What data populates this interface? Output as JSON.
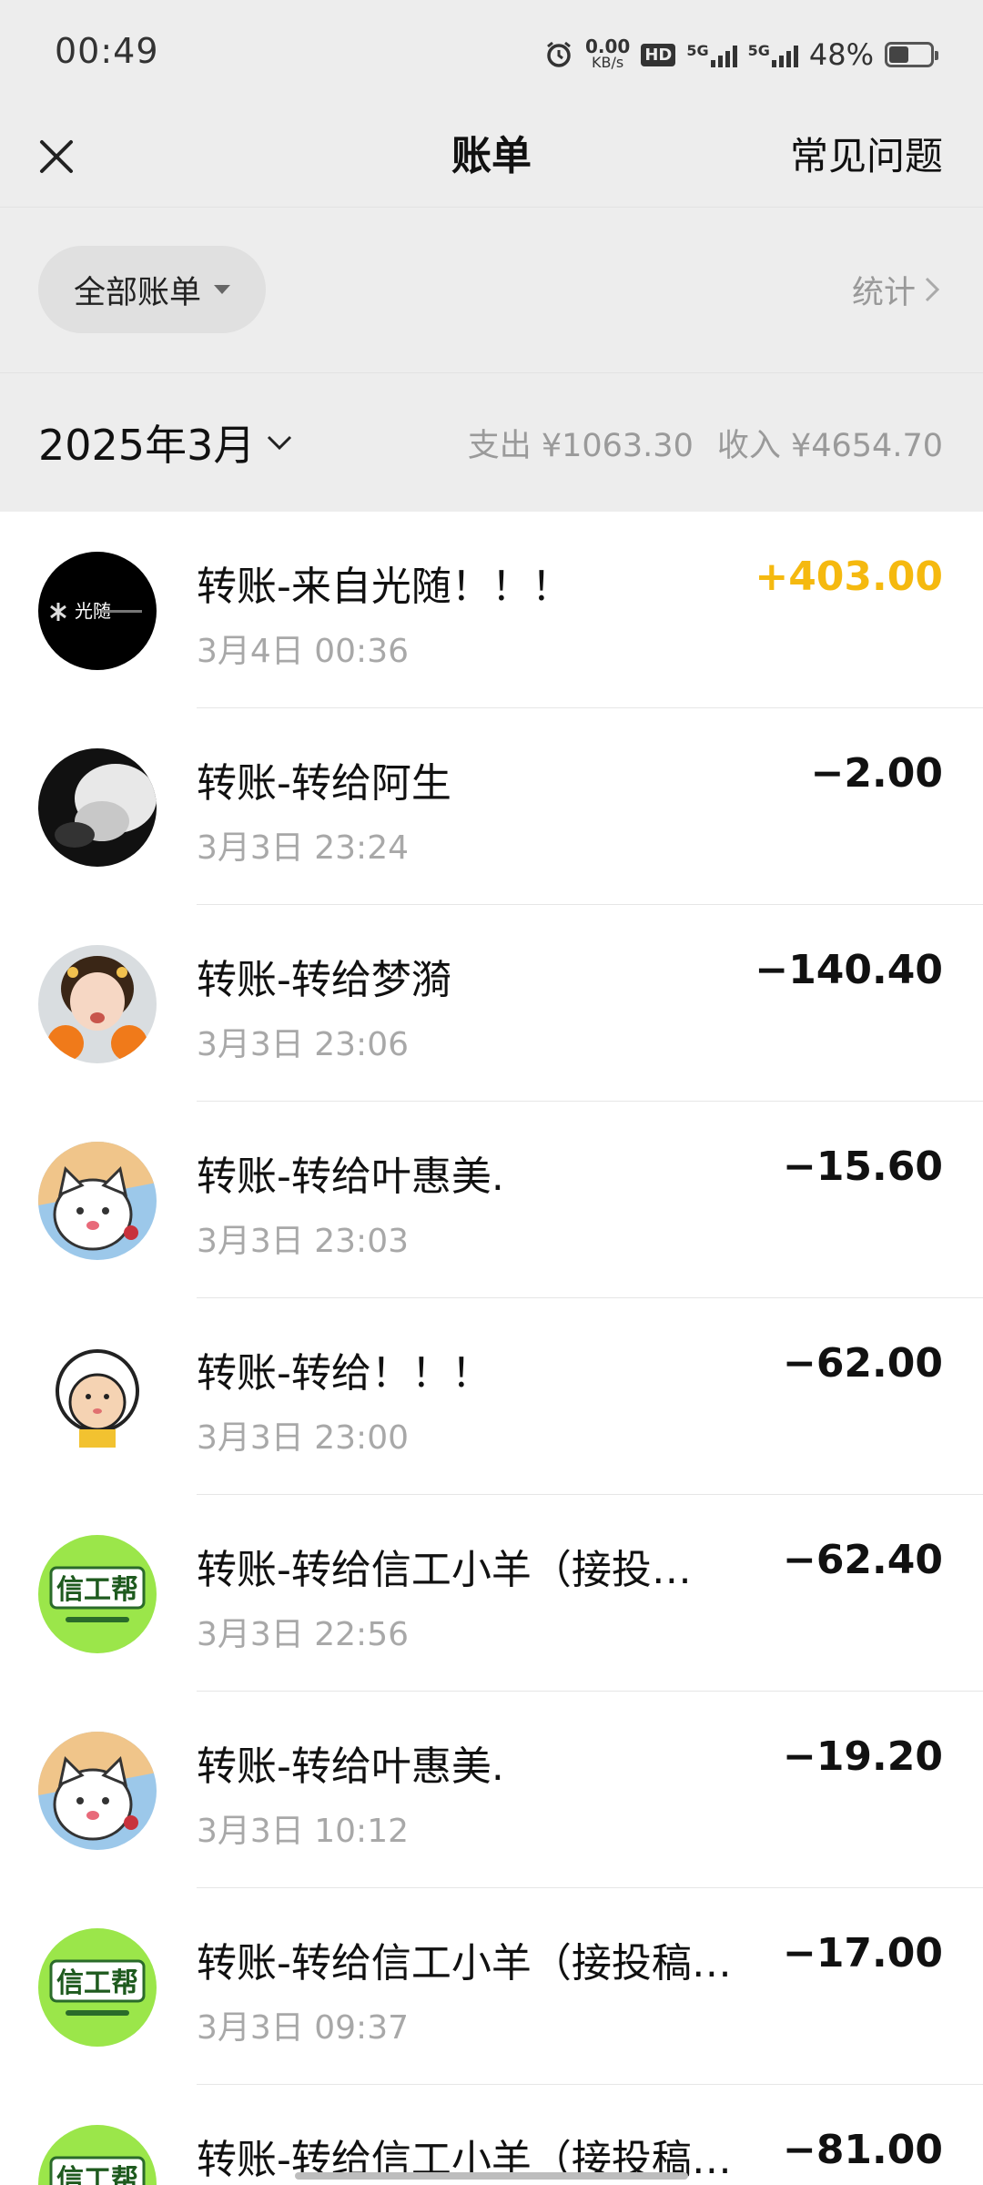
{
  "status_bar": {
    "time": "00:49",
    "net_speed_value": "0.00",
    "net_speed_unit": "KB/s",
    "hd_label": "HD",
    "signal_label_1": "5G",
    "signal_label_2": "5G",
    "battery_text": "48%",
    "battery_level": 0.48
  },
  "nav": {
    "title": "账单",
    "faq_label": "常见问题"
  },
  "filter": {
    "chip_label": "全部账单",
    "stats_label": "统计"
  },
  "month": {
    "label": "2025年3月",
    "expense": "支出 ¥1063.30",
    "income": "收入 ¥4654.70"
  },
  "colors": {
    "income_amount": "#f5b90f",
    "page_background": "#ededed",
    "list_background": "#ffffff"
  },
  "bills": [
    {
      "title": "转账-来自光随！！！",
      "time": "3月4日 00:36",
      "amount": "+403.00",
      "type": "income",
      "avatar": "brand-logo-avatar"
    },
    {
      "title": "转账-转给阿生",
      "time": "3月3日 23:24",
      "amount": "−2.00",
      "type": "expense",
      "avatar": "dark-photo-avatar"
    },
    {
      "title": "转账-转给梦漪",
      "time": "3月3日 23:06",
      "amount": "−140.40",
      "type": "expense",
      "avatar": "girl-photo-avatar"
    },
    {
      "title": "转账-转给叶惠美.",
      "time": "3月3日 23:03",
      "amount": "−15.60",
      "type": "expense",
      "avatar": "cat-cartoon-avatar"
    },
    {
      "title": "转账-转给！！！",
      "time": "3月3日 23:00",
      "amount": "−62.00",
      "type": "expense",
      "avatar": "sheep-cartoon-avatar"
    },
    {
      "title": "转账-转给信工小羊（接投…",
      "time": "3月3日 22:56",
      "amount": "−62.40",
      "type": "expense",
      "avatar": "xingongbang-avatar"
    },
    {
      "title": "转账-转给叶惠美.",
      "time": "3月3日 10:12",
      "amount": "−19.20",
      "type": "expense",
      "avatar": "cat-cartoon-avatar"
    },
    {
      "title": "转账-转给信工小羊（接投稿…",
      "time": "3月3日 09:37",
      "amount": "−17.00",
      "type": "expense",
      "avatar": "xingongbang-avatar"
    },
    {
      "title": "转账-转给信工小羊（接投稿…",
      "time": "",
      "amount": "−81.00",
      "type": "expense",
      "avatar": "xingongbang-avatar"
    }
  ],
  "avatar_texts": {
    "brand_logo": "光随",
    "xingongbang": "信工帮"
  }
}
